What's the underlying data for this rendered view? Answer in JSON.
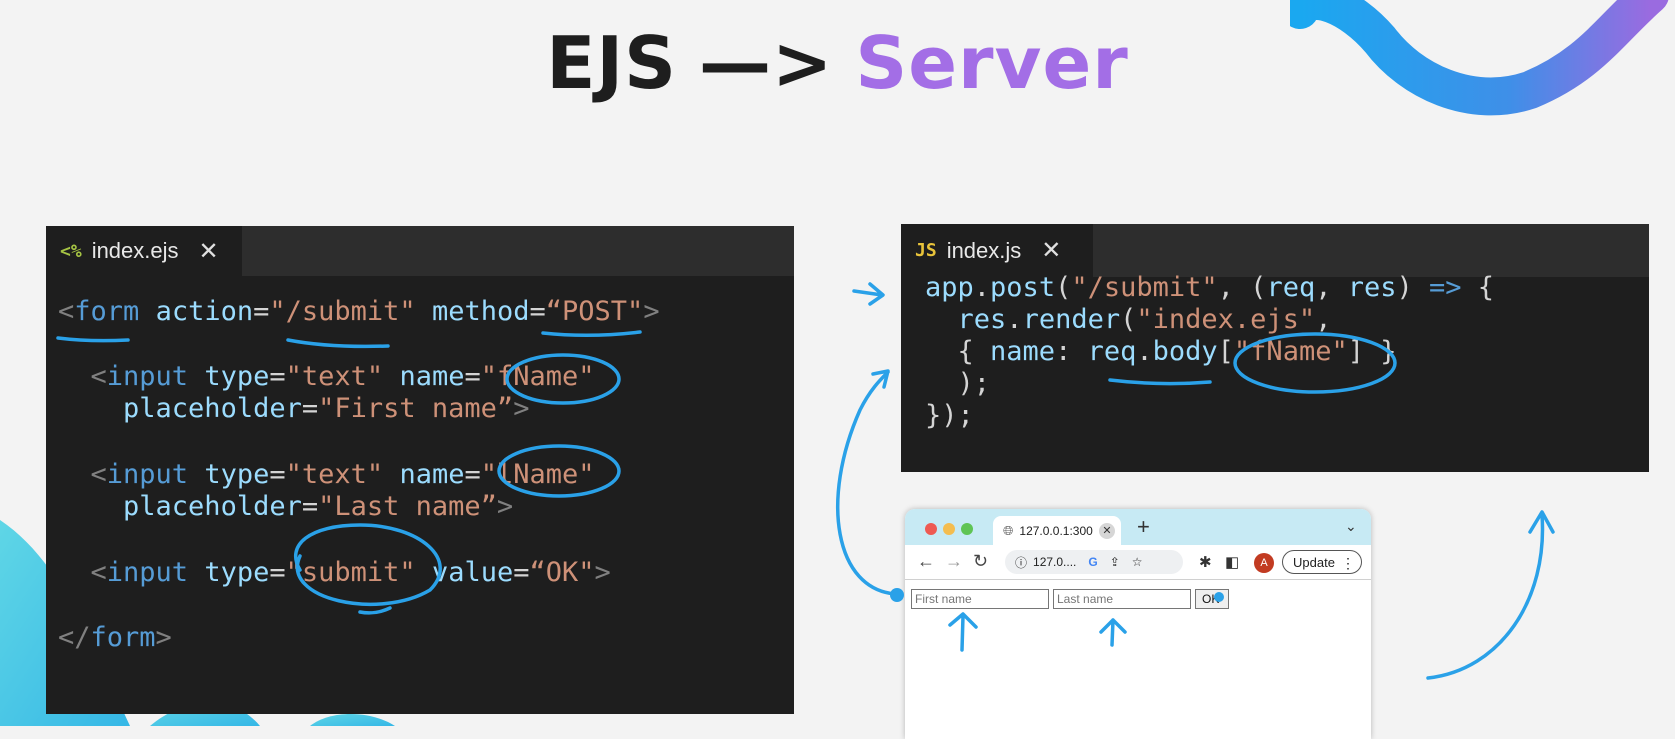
{
  "title": {
    "part1": "EJS",
    "arrow": "—>",
    "part2": "Server"
  },
  "left_editor": {
    "tab_icon": "<%",
    "tab_label": "index.ejs",
    "close_glyph": "✕",
    "lines": [
      [
        [
          "p",
          "<"
        ],
        [
          "k",
          "form"
        ],
        [
          "w",
          " "
        ],
        [
          "a",
          "action"
        ],
        [
          "w",
          "="
        ],
        [
          "s",
          "\"/submit\""
        ],
        [
          "w",
          " "
        ],
        [
          "a",
          "method"
        ],
        [
          "w",
          "="
        ],
        [
          "s",
          "“POST\""
        ],
        [
          "p",
          ">"
        ]
      ],
      [
        [
          "w",
          "  "
        ],
        [
          "p",
          "<"
        ],
        [
          "k",
          "input"
        ],
        [
          "w",
          " "
        ],
        [
          "a",
          "type"
        ],
        [
          "w",
          "="
        ],
        [
          "s",
          "\"text\""
        ],
        [
          "w",
          " "
        ],
        [
          "a",
          "name"
        ],
        [
          "w",
          "="
        ],
        [
          "s",
          "\"fName\""
        ]
      ],
      [
        [
          "w",
          "    "
        ],
        [
          "a",
          "placeholder"
        ],
        [
          "w",
          "="
        ],
        [
          "s",
          "\"First name”"
        ],
        [
          "p",
          ">"
        ]
      ],
      [
        [
          "w",
          "  "
        ],
        [
          "p",
          "<"
        ],
        [
          "k",
          "input"
        ],
        [
          "w",
          " "
        ],
        [
          "a",
          "type"
        ],
        [
          "w",
          "="
        ],
        [
          "s",
          "\"text\""
        ],
        [
          "w",
          " "
        ],
        [
          "a",
          "name"
        ],
        [
          "w",
          "="
        ],
        [
          "s",
          "\"lName\""
        ]
      ],
      [
        [
          "w",
          "    "
        ],
        [
          "a",
          "placeholder"
        ],
        [
          "w",
          "="
        ],
        [
          "s",
          "\"Last name”"
        ],
        [
          "p",
          ">"
        ]
      ],
      [
        [
          "w",
          "  "
        ],
        [
          "p",
          "<"
        ],
        [
          "k",
          "input"
        ],
        [
          "w",
          " "
        ],
        [
          "a",
          "type"
        ],
        [
          "w",
          "="
        ],
        [
          "s",
          "\"submit\""
        ],
        [
          "w",
          " "
        ],
        [
          "a",
          "value"
        ],
        [
          "w",
          "="
        ],
        [
          "s",
          "“OK\""
        ],
        [
          "p",
          ">"
        ]
      ],
      [
        [
          "p",
          "</"
        ],
        [
          "k",
          "form"
        ],
        [
          "p",
          ">"
        ]
      ]
    ]
  },
  "right_editor": {
    "tab_icon": "JS",
    "tab_label": "index.js",
    "close_glyph": "✕",
    "lines": [
      [
        [
          "a",
          "app"
        ],
        [
          "w",
          "."
        ],
        [
          "a",
          "post"
        ],
        [
          "w",
          "("
        ],
        [
          "s",
          "\"/submit\""
        ],
        [
          "w",
          ", ("
        ],
        [
          "a",
          "req"
        ],
        [
          "w",
          ", "
        ],
        [
          "a",
          "res"
        ],
        [
          "w",
          ") "
        ],
        [
          "k",
          "=>"
        ],
        [
          "w",
          " {"
        ]
      ],
      [
        [
          "w",
          "  "
        ],
        [
          "a",
          "res"
        ],
        [
          "w",
          "."
        ],
        [
          "a",
          "render"
        ],
        [
          "w",
          "("
        ],
        [
          "s",
          "\"index.ejs\""
        ],
        [
          "w",
          ","
        ]
      ],
      [
        [
          "w",
          "  { "
        ],
        [
          "a",
          "name"
        ],
        [
          "w",
          ": "
        ],
        [
          "a",
          "req"
        ],
        [
          "w",
          "."
        ],
        [
          "a",
          "body"
        ],
        [
          "w",
          "["
        ],
        [
          "s",
          "\"fName\""
        ],
        [
          "w",
          "] }"
        ]
      ],
      [
        [
          "w",
          "  );"
        ]
      ],
      [
        [
          "w",
          "});"
        ]
      ]
    ]
  },
  "browser": {
    "tab_title": "127.0.0.1:300",
    "tab_close": "✕",
    "new_tab": "+",
    "tab_menu": "⌄",
    "back": "←",
    "forward": "→",
    "reload": "↻",
    "address": "127.0....",
    "info_icon": "ⓘ",
    "google_icon": "G",
    "share_icon": "⇪",
    "star_icon": "☆",
    "extensions_icon": "✱",
    "sidepanel_icon": "◧",
    "avatar_letter": "A",
    "update_label": "Update",
    "first_placeholder": "First name",
    "last_placeholder": "Last name",
    "ok_label": "OK"
  },
  "colors": {
    "accent_purple": "#a36ee6",
    "annotation_blue": "#2aa1e8",
    "editor_bg": "#1e1e1e"
  }
}
